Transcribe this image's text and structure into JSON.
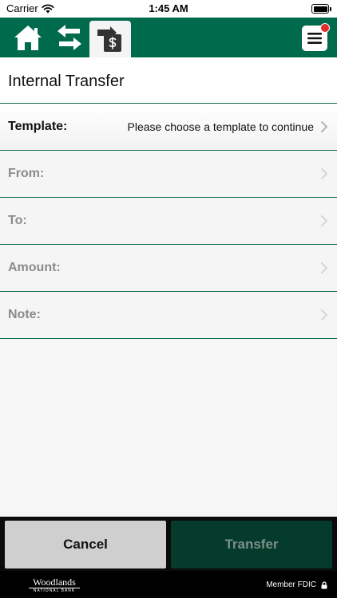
{
  "status_bar": {
    "carrier": "Carrier",
    "time": "1:45 AM"
  },
  "nav": {
    "icons": [
      "home-icon",
      "transfer-arrows-icon",
      "transfer-dollar-icon",
      "menu-icon"
    ],
    "colors": {
      "nav_bg": "#006b4c",
      "accent_line": "#0c6b4c",
      "badge": "#e32b2b"
    }
  },
  "page": {
    "title": "Internal Transfer"
  },
  "form": {
    "rows": [
      {
        "label": "Template:",
        "value": "Please choose a template to continue"
      },
      {
        "label": "From:",
        "value": ""
      },
      {
        "label": "To:",
        "value": ""
      },
      {
        "label": "Amount:",
        "value": ""
      },
      {
        "label": "Note:",
        "value": ""
      }
    ]
  },
  "actions": {
    "cancel_label": "Cancel",
    "transfer_label": "Transfer"
  },
  "footer": {
    "logo_main": "Woodlands",
    "logo_sub": "NATIONAL BANK",
    "fdic": "Member FDIC"
  }
}
